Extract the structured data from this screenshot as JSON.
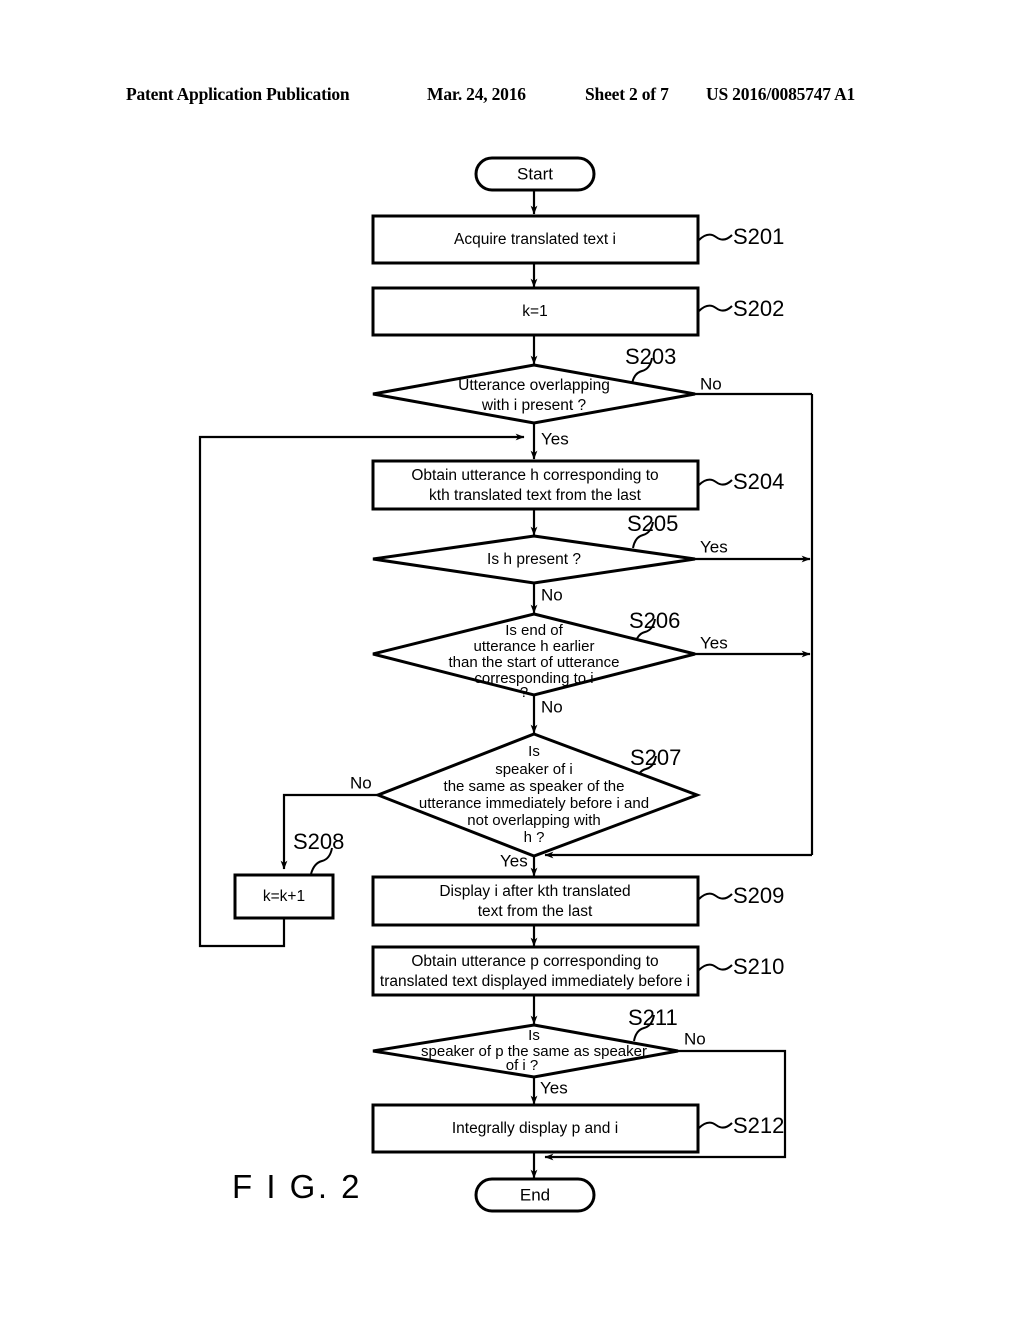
{
  "header": {
    "publication": "Patent Application Publication",
    "date": "Mar. 24, 2016",
    "sheet": "Sheet 2 of 7",
    "patent_number": "US 2016/0085747 A1"
  },
  "figure": {
    "caption": "F I G. 2"
  },
  "chart_data": {
    "type": "diagram",
    "title": "FIG. 2",
    "nodes": [
      {
        "id": "start",
        "kind": "terminal",
        "label": "Start"
      },
      {
        "id": "s201",
        "kind": "process",
        "step": "S201",
        "lines": [
          "Acquire translated text i"
        ]
      },
      {
        "id": "s202",
        "kind": "process",
        "step": "S202",
        "lines": [
          "k=1"
        ]
      },
      {
        "id": "s203",
        "kind": "decision",
        "step": "S203",
        "lines": [
          "Utterance overlapping",
          "with i present ?"
        ],
        "yes": "down",
        "no": "right"
      },
      {
        "id": "s204",
        "kind": "process",
        "step": "S204",
        "lines": [
          "Obtain utterance h corresponding to",
          "kth translated text from the last"
        ]
      },
      {
        "id": "s205",
        "kind": "decision",
        "step": "S205",
        "lines": [
          "Is h present ?"
        ],
        "yes": "right",
        "no": "down"
      },
      {
        "id": "s206",
        "kind": "decision",
        "step": "S206",
        "lines": [
          "Is end of",
          "utterance h earlier",
          "than the start of utterance",
          "corresponding to i",
          "?"
        ],
        "yes": "right",
        "no": "down"
      },
      {
        "id": "s207",
        "kind": "decision",
        "step": "S207",
        "lines": [
          "Is",
          "speaker of i",
          "the same as speaker of the",
          "utterance immediately before i and",
          "not overlapping with",
          "h ?"
        ],
        "yes": "down",
        "no": "left"
      },
      {
        "id": "s208",
        "kind": "process",
        "step": "S208",
        "lines": [
          "k=k+1"
        ]
      },
      {
        "id": "s209",
        "kind": "process",
        "step": "S209",
        "lines": [
          "Display i after kth translated",
          "text from the last"
        ]
      },
      {
        "id": "s210",
        "kind": "process",
        "step": "S210",
        "lines": [
          "Obtain utterance p corresponding to",
          "translated text displayed immediately before i"
        ]
      },
      {
        "id": "s211",
        "kind": "decision",
        "step": "S211",
        "lines": [
          "Is",
          "speaker of p the same as speaker",
          "of i ?"
        ],
        "yes": "down",
        "no": "right"
      },
      {
        "id": "s212",
        "kind": "process",
        "step": "S212",
        "lines": [
          "Integrally display p and i"
        ]
      },
      {
        "id": "end",
        "kind": "terminal",
        "label": "End"
      }
    ],
    "edges": [
      {
        "from": "start",
        "to": "s201",
        "label": ""
      },
      {
        "from": "s201",
        "to": "s202",
        "label": ""
      },
      {
        "from": "s202",
        "to": "s203",
        "label": ""
      },
      {
        "from": "s203",
        "to": "s204",
        "label": "Yes"
      },
      {
        "from": "s203",
        "to": "s209",
        "label": "No"
      },
      {
        "from": "s204",
        "to": "s205",
        "label": ""
      },
      {
        "from": "s205",
        "to": "s209",
        "label": "Yes"
      },
      {
        "from": "s205",
        "to": "s206",
        "label": "No"
      },
      {
        "from": "s206",
        "to": "s209",
        "label": "Yes"
      },
      {
        "from": "s206",
        "to": "s207",
        "label": "No"
      },
      {
        "from": "s207",
        "to": "s209",
        "label": "Yes"
      },
      {
        "from": "s207",
        "to": "s208",
        "label": "No"
      },
      {
        "from": "s208",
        "to": "s204",
        "label": ""
      },
      {
        "from": "s209",
        "to": "s210",
        "label": ""
      },
      {
        "from": "s210",
        "to": "s211",
        "label": ""
      },
      {
        "from": "s211",
        "to": "s212",
        "label": "Yes"
      },
      {
        "from": "s211",
        "to": "end",
        "label": "No"
      },
      {
        "from": "s212",
        "to": "end",
        "label": ""
      }
    ]
  },
  "nodes": {
    "start": {
      "label": "Start"
    },
    "end": {
      "label": "End"
    },
    "s201": {
      "step": "S201",
      "l0": "Acquire translated text i"
    },
    "s202": {
      "step": "S202",
      "l0": "k=1"
    },
    "s203": {
      "step": "S203",
      "l0": "Utterance overlapping",
      "l1": "with i present ?"
    },
    "s204": {
      "step": "S204",
      "l0": "Obtain utterance h corresponding to",
      "l1": "kth translated text from the last"
    },
    "s205": {
      "step": "S205",
      "l0": "Is h present ?"
    },
    "s206": {
      "step": "S206",
      "l0": "Is end of",
      "l1": "utterance h earlier",
      "l2": "than the start of utterance",
      "l3": "corresponding to i",
      "l4": "?"
    },
    "s207": {
      "step": "S207",
      "l0": "Is",
      "l1": "speaker of i",
      "l2": "the same as speaker of the",
      "l3": "utterance immediately before i and",
      "l4": "not overlapping with",
      "l5": "h ?"
    },
    "s208": {
      "step": "S208",
      "l0": "k=k+1"
    },
    "s209": {
      "step": "S209",
      "l0": "Display i after kth translated",
      "l1": "text from the last"
    },
    "s210": {
      "step": "S210",
      "l0": "Obtain utterance p corresponding to",
      "l1": "translated text displayed immediately before i"
    },
    "s211": {
      "step": "S211",
      "l0": "Is",
      "l1": "speaker of p the same as speaker",
      "l2": "of i ?"
    },
    "s212": {
      "step": "S212",
      "l0": "Integrally display p and i"
    }
  },
  "branch_labels": {
    "s203_no": "No",
    "s203_yes": "Yes",
    "s205_yes": "Yes",
    "s205_no": "No",
    "s206_yes": "Yes",
    "s206_no": "No",
    "s207_no": "No",
    "s207_yes": "Yes",
    "s211_no": "No",
    "s211_yes": "Yes"
  },
  "colors": {
    "ink": "#000000",
    "paper": "#ffffff"
  }
}
